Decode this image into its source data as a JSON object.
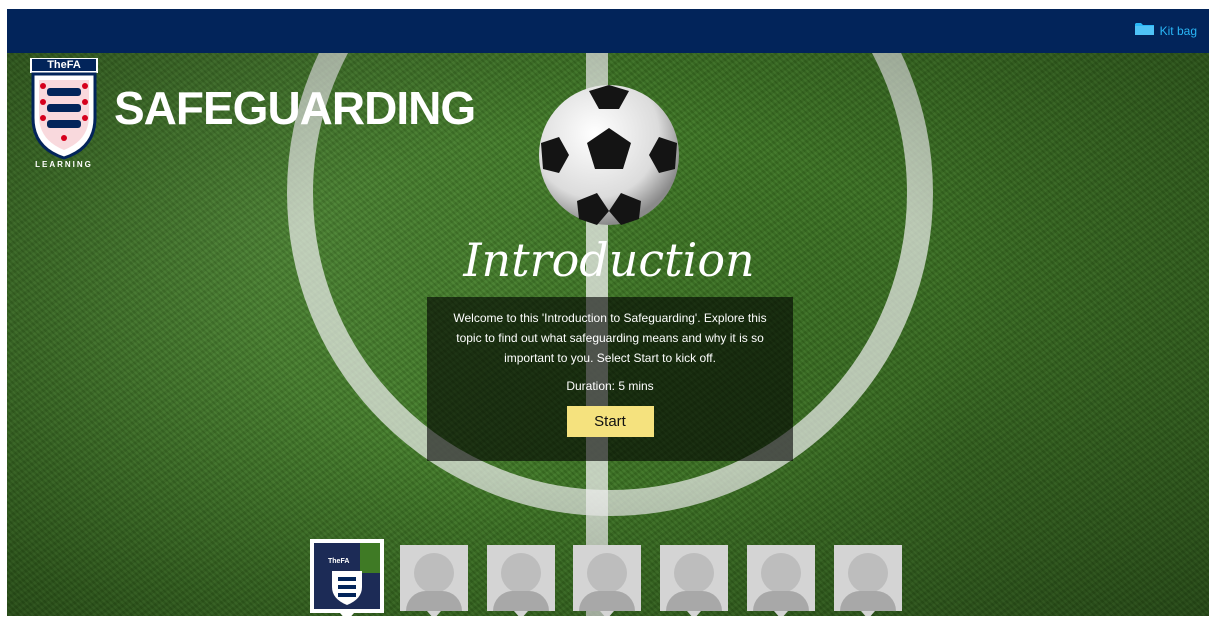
{
  "header": {
    "kitbag_label": "Kit bag",
    "kitbag_icon": "folder-icon"
  },
  "brand": {
    "logo_top": "TheFA",
    "logo_bottom": "LEARNING",
    "title": "SAFEGUARDING"
  },
  "intro": {
    "title": "Introduction",
    "body": "Welcome to this 'Introduction to Safeguarding'. Explore this topic to find out what safeguarding means and why it is so important to you. Select Start to kick off.",
    "duration": "Duration: 5 mins",
    "start_label": "Start"
  },
  "thumbnails": {
    "count": 7,
    "active_index": 0,
    "active_badge": "TheFA"
  },
  "colors": {
    "topbar": "#02245a",
    "kitbag": "#29b6f6",
    "start_button": "#f5e27e",
    "grass": "#3f7a25"
  }
}
